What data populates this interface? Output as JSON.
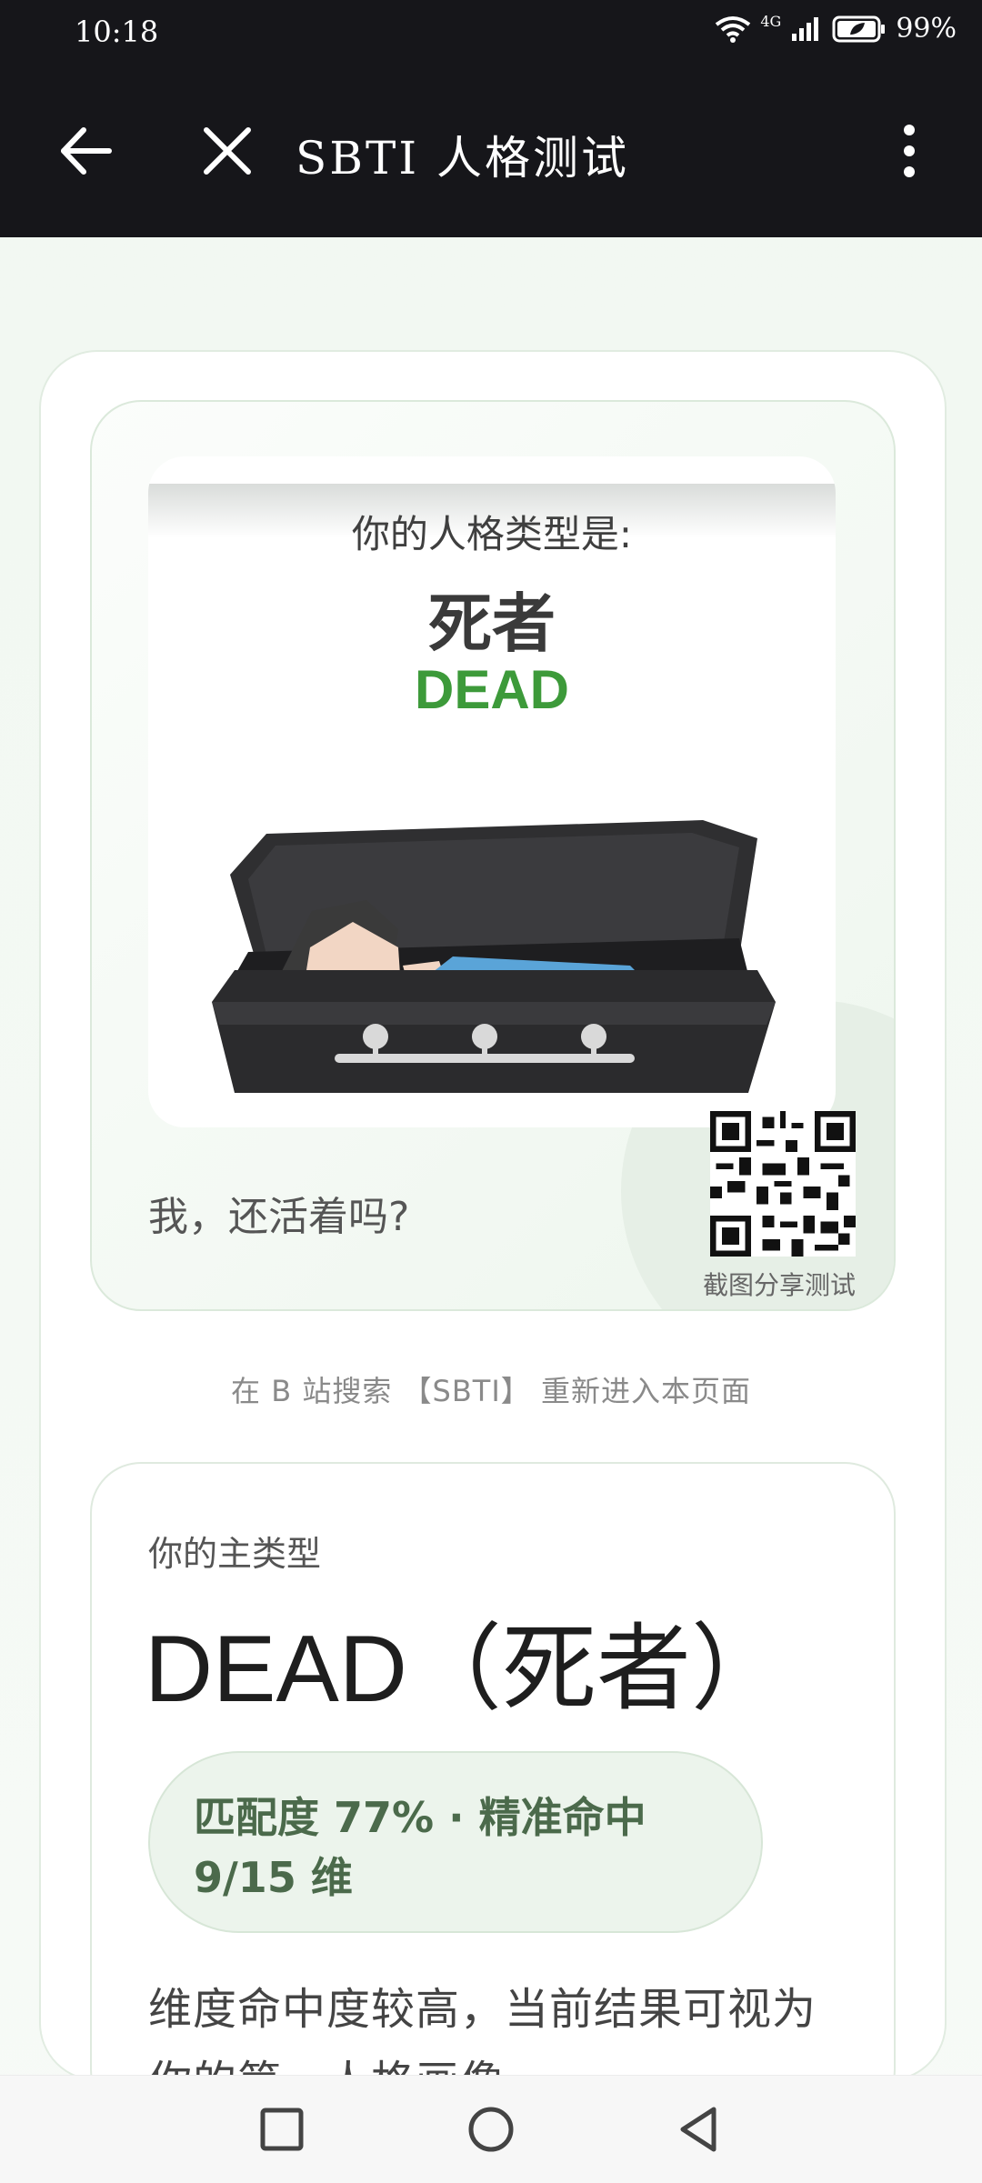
{
  "status": {
    "time": "10:18",
    "network": "4G",
    "battery": "99%"
  },
  "toolbar": {
    "title": "SBTI 人格测试"
  },
  "poster": {
    "label": "你的人格类型是:",
    "type_name": "死者",
    "type_code": "DEAD"
  },
  "share": {
    "question": "我，还活着吗?",
    "qr_label": "截图分享测试"
  },
  "hint": "在 B 站搜索 【SBTI】 重新进入本页面",
  "result": {
    "small_label": "你的主类型",
    "type_title": "DEAD（死者）",
    "match_text": "匹配度 77% · 精准命中 9/15 维",
    "description": "维度命中度较高，当前结果可视为你的第一人格画像。"
  },
  "colors": {
    "accent_green": "#3d9a3a",
    "dark_bar": "#16161a"
  },
  "icons": [
    "wifi-icon",
    "signal-icon",
    "battery-icon",
    "back-arrow-icon",
    "close-icon",
    "more-vertical-icon",
    "qr-code-icon",
    "nav-recents-icon",
    "nav-home-icon",
    "nav-back-icon"
  ]
}
